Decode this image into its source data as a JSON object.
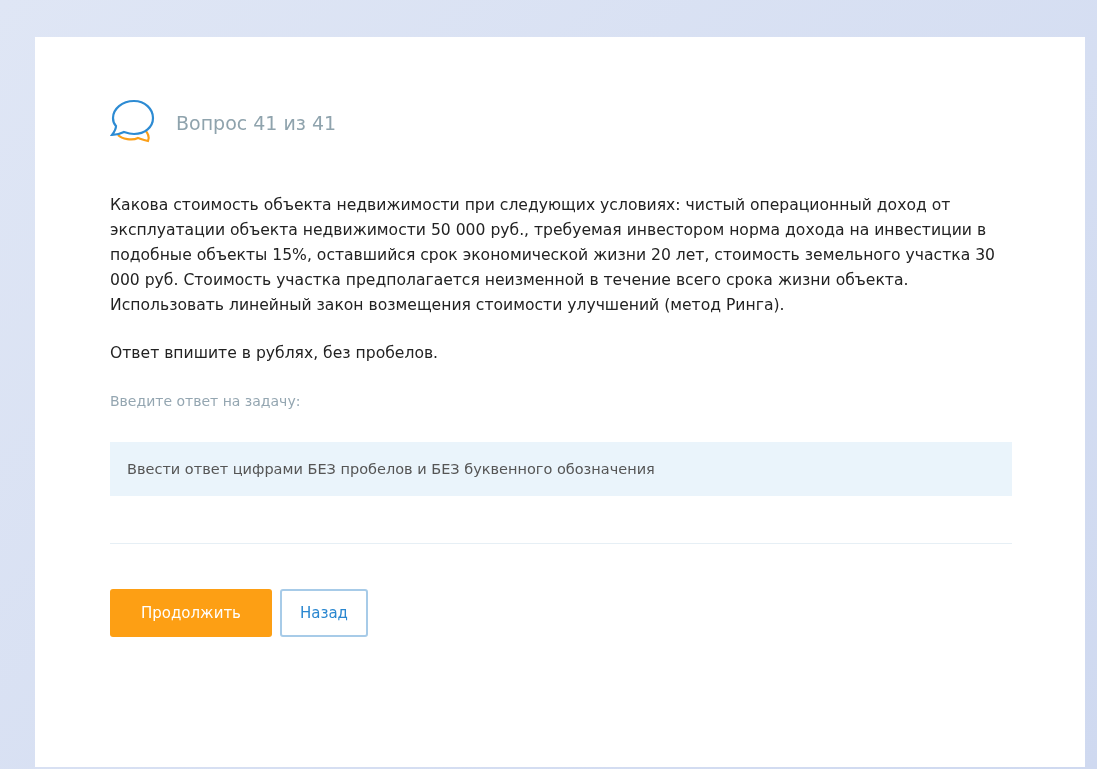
{
  "header": {
    "title": "Вопрос 41 из 41"
  },
  "question": {
    "text": "Какова стоимость объекта недвижимости при следующих условиях: чистый операционный доход от эксплуатации объекта недвижимости 50 000 руб., требуемая инвестором норма дохода на инвестиции в подобные объекты 15%, оставшийся срок экономической жизни 20 лет, стоимость земельного участка 30 000 руб. Стоимость участка предполагается неизменной в течение всего срока жизни объекта. Использовать линейный закон возмещения стоимости улучшений (метод Ринга).",
    "instruction": "Ответ впишите в рублях, без пробелов."
  },
  "answer": {
    "label": "Введите ответ на задачу:",
    "placeholder": "Ввести ответ цифрами БЕЗ пробелов и БЕЗ буквенного обозначения"
  },
  "buttons": [
    {
      "label": "Продолжить",
      "kind": "primary"
    },
    {
      "label": "Назад",
      "kind": "secondary"
    }
  ]
}
